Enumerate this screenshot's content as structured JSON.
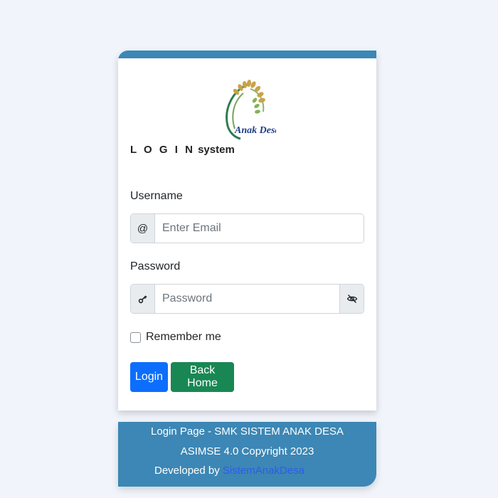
{
  "login": {
    "title_spaced": "L O G I N",
    "title_rest": "system",
    "logo_text": "Anak Desa",
    "username_label": "Username",
    "username_addon": "@",
    "username_placeholder": "Enter Email",
    "password_label": "Password",
    "password_placeholder": "Password",
    "remember_label": "Remember me",
    "login_button": "Login",
    "back_home_button": "Back Home"
  },
  "footer": {
    "line1": "Login Page - SMK SISTEM ANAK DESA",
    "line2": "ASIMSE 4.0 Copyright 2023",
    "developed_by": "Developed by",
    "developer_link": "SistemAnakDesa"
  },
  "icons": {
    "at": "at-icon",
    "key": "key-icon",
    "password_toggle": "eye-slash-icon",
    "logo": "rice-plant-logo"
  },
  "colors": {
    "accent_bar": "#3c87b5",
    "login_button": "#0d6efd",
    "back_home_button": "#198754",
    "footer_bg": "#3c87b5",
    "link": "#2f5bea",
    "page_bg": "#f1f5fb"
  }
}
